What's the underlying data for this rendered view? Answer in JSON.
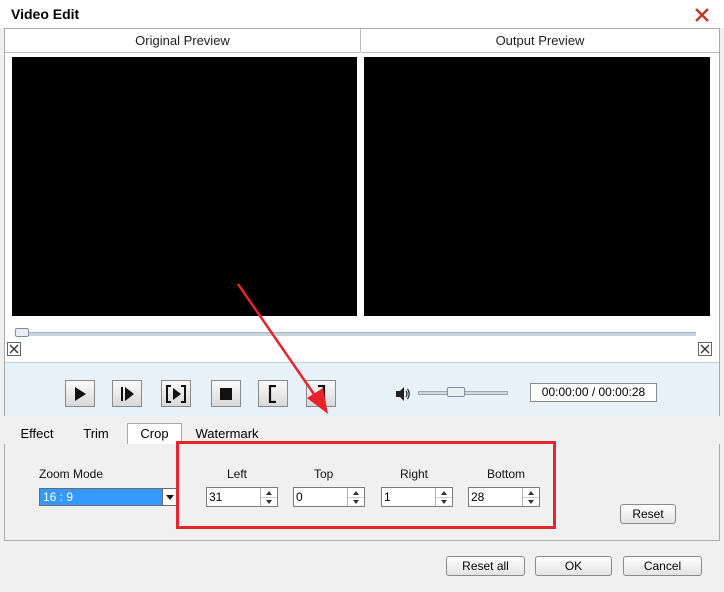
{
  "window": {
    "title": "Video Edit"
  },
  "preview": {
    "original_label": "Original Preview",
    "output_label": "Output Preview"
  },
  "player": {
    "time": "00:00:00 / 00:00:28",
    "volume": 0.4,
    "progress": 0.0
  },
  "tabs": [
    {
      "label": "Effect"
    },
    {
      "label": "Trim"
    },
    {
      "label": "Crop"
    },
    {
      "label": "Watermark"
    }
  ],
  "active_tab": "Crop",
  "crop": {
    "zoom_mode_label": "Zoom Mode",
    "zoom_mode_value": "16 : 9",
    "left_label": "Left",
    "left_value": "31",
    "top_label": "Top",
    "top_value": "0",
    "right_label": "Right",
    "right_value": "1",
    "bottom_label": "Bottom",
    "bottom_value": "28",
    "reset_label": "Reset"
  },
  "footer": {
    "reset_all_label": "Reset all",
    "ok_label": "OK",
    "cancel_label": "Cancel"
  },
  "colors": {
    "annotation": "#e8232a",
    "selection": "#3399ff",
    "screen": "#000000"
  }
}
